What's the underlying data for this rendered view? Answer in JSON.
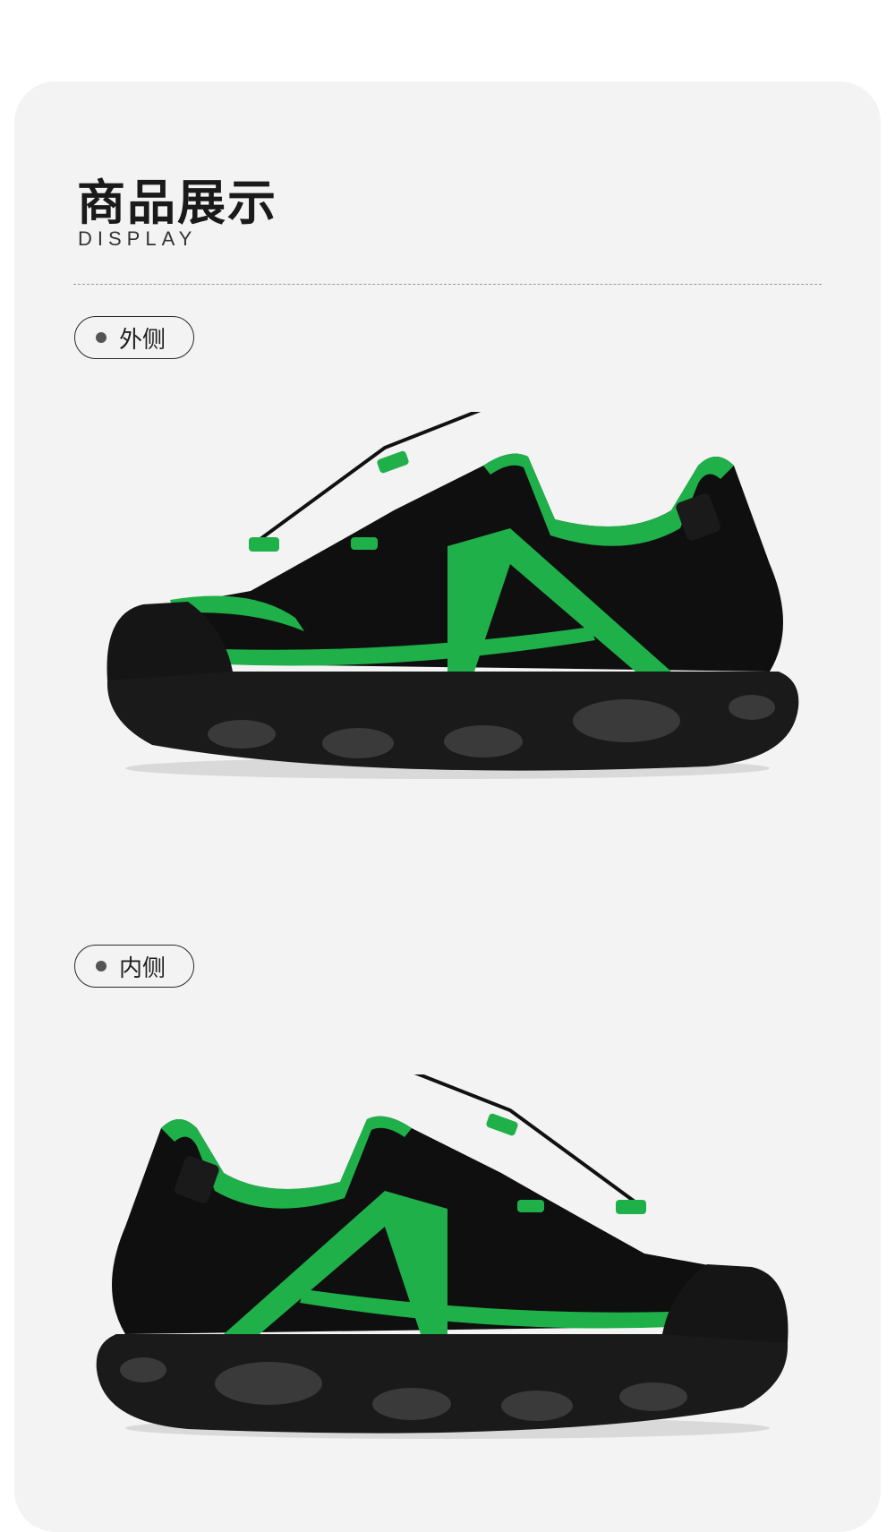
{
  "header": {
    "title": "商品展示",
    "subtitle": "DISPLAY"
  },
  "views": [
    {
      "label": "外侧",
      "image": "shoe-outer-side"
    },
    {
      "label": "内侧",
      "image": "shoe-inner-side"
    }
  ],
  "colors": {
    "card_background": "#f3f3f3",
    "shoe_black": "#111111",
    "accent_green": "#1fb04a"
  }
}
